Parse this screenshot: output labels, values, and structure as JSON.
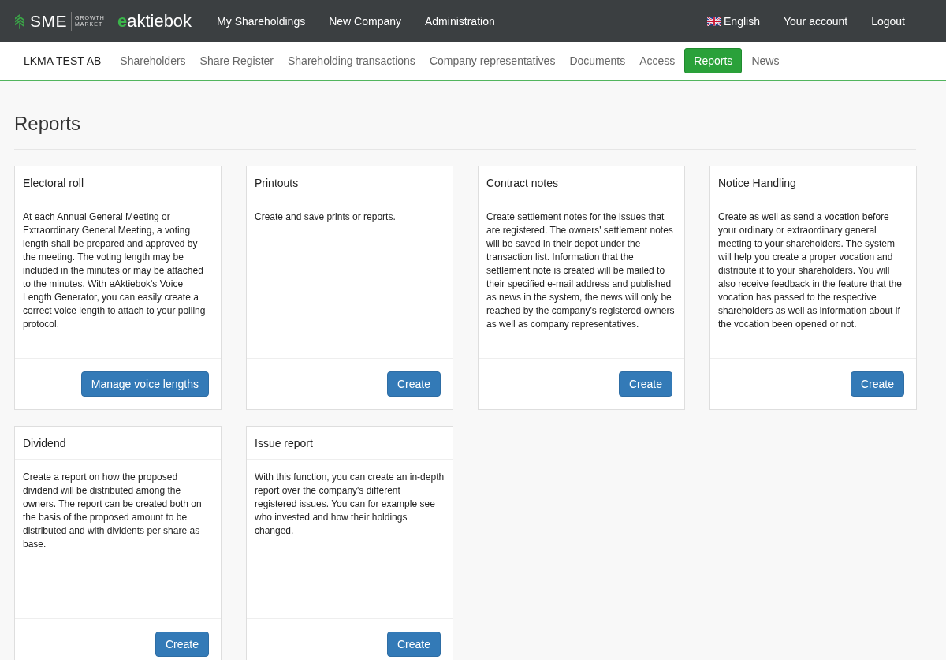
{
  "brand": {
    "sme": "SME",
    "tagline_top": "GROWTH",
    "tagline_bottom": "MARKET",
    "mark": "e",
    "name": "aktiebok"
  },
  "top_nav": [
    {
      "label": "My Shareholdings"
    },
    {
      "label": "New Company"
    },
    {
      "label": "Administration"
    }
  ],
  "user_nav": [
    {
      "label": "English",
      "kind": "language"
    },
    {
      "label": "Your account",
      "kind": "link"
    },
    {
      "label": "Logout",
      "kind": "link"
    }
  ],
  "company": "LKMA TEST AB",
  "tabs": [
    {
      "label": "Shareholders",
      "selected": false
    },
    {
      "label": "Share Register",
      "selected": false
    },
    {
      "label": "Shareholding transactions",
      "selected": false
    },
    {
      "label": "Company representatives",
      "selected": false
    },
    {
      "label": "Documents",
      "selected": false
    },
    {
      "label": "Access",
      "selected": false
    },
    {
      "label": "Reports",
      "selected": true
    },
    {
      "label": "News",
      "selected": false
    }
  ],
  "page_title": "Reports",
  "cards": [
    {
      "title": "Electoral roll",
      "text": "At each Annual General Meeting or Extraordinary General Meeting, a voting length shall be prepared and approved by the meeting. The voting length may be included in the minutes or may be attached to the minutes. With eAktiebok's Voice Length Generator, you can easily create a correct voice length to attach to your polling protocol.",
      "button": "Manage voice lengths"
    },
    {
      "title": "Printouts",
      "text": "Create and save prints or reports.",
      "button": "Create"
    },
    {
      "title": "Contract notes",
      "text": "Create settlement notes for the issues that are registered. The owners' settlement notes will be saved in their depot under the transaction list. Information that the settlement note is created will be mailed to their specified e-mail address and published as news in the system, the news will only be reached by the company's registered owners as well as company representatives.",
      "button": "Create"
    },
    {
      "title": "Notice Handling",
      "text": "Create as well as send a vocation before your ordinary or extraordinary general meeting to your shareholders. The system will help you create a proper vocation and distribute it to your shareholders. You will also receive feedback in the feature that the vocation has passed to the respective shareholders as well as information about if the vocation been opened or not.",
      "button": "Create"
    },
    {
      "title": "Dividend",
      "text": "Create a report on how the proposed dividend will be distributed among the owners. The report can be created both on the basis of the proposed amount to be distributed and with dividents per share as base.",
      "button": "Create"
    },
    {
      "title": "Issue report",
      "text": "With this function, you can create an in-depth report over the company's different registered issues. You can for example see who invested and how their holdings changed.",
      "button": "Create"
    }
  ]
}
